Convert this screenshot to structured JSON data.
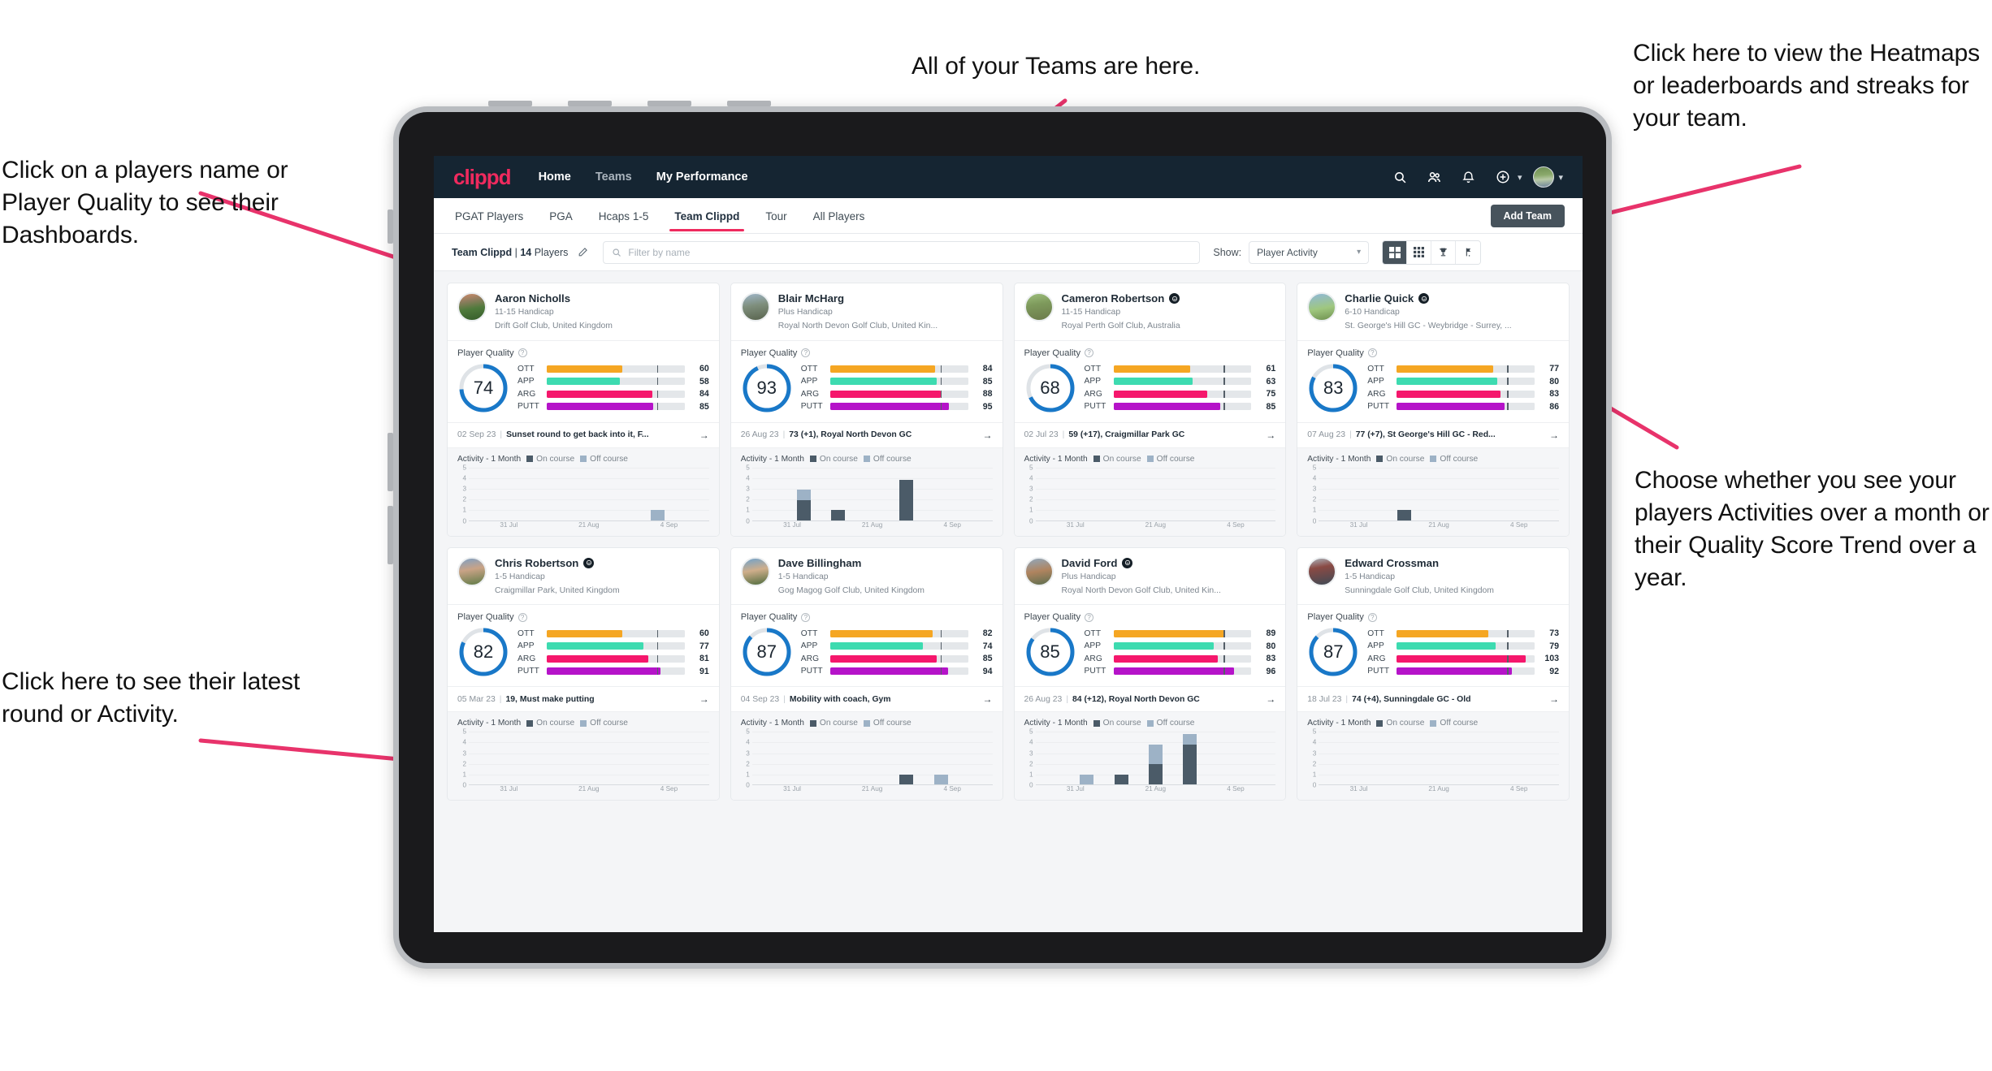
{
  "annotations": [
    {
      "id": "anno-players",
      "text": "Click on a players name or Player Quality to see their Dashboards."
    },
    {
      "id": "anno-teams",
      "text": "All of your Teams are here."
    },
    {
      "id": "anno-heatmaps",
      "text": "Click here to view the Heatmaps or leaderboards and streaks for your team."
    },
    {
      "id": "anno-activity-toggle",
      "text": "Choose whether you see your players Activities over a month or their Quality Score Trend over a year."
    },
    {
      "id": "anno-latest-round",
      "text": "Click here to see their latest round or Activity."
    }
  ],
  "topnav": {
    "logo": "clippd",
    "links": [
      {
        "label": "Home",
        "active": true
      },
      {
        "label": "Teams",
        "active": false
      },
      {
        "label": "My Performance",
        "active": true
      }
    ],
    "icons": [
      "search-icon",
      "people-icon",
      "bell-icon",
      "plus-circle-icon",
      "avatar-icon"
    ]
  },
  "tabs": {
    "items": [
      {
        "label": "PGAT Players",
        "active": false
      },
      {
        "label": "PGA",
        "active": false
      },
      {
        "label": "Hcaps 1-5",
        "active": false
      },
      {
        "label": "Team Clippd",
        "active": true
      },
      {
        "label": "Tour",
        "active": false
      },
      {
        "label": "All Players",
        "active": false
      }
    ],
    "add_team_label": "Add Team"
  },
  "filterbar": {
    "team_name": "Team Clippd",
    "separator": "|",
    "player_count": "14",
    "players_word": "Players",
    "edit_icon": "pencil-icon",
    "search_placeholder": "Filter by name",
    "show_label": "Show:",
    "show_value": "Player Activity",
    "views": [
      {
        "icon": "grid-large-icon",
        "active": true
      },
      {
        "icon": "grid-dense-icon",
        "active": false
      },
      {
        "icon": "trophy-icon",
        "active": false
      },
      {
        "icon": "golf-flag-icon",
        "active": false
      }
    ]
  },
  "metric_colors": {
    "OTT": "#f5a623",
    "APP": "#3ddbb0",
    "ARG": "#f5176c",
    "PUTT": "#b513c9",
    "ring": "#1978c8",
    "ring_track": "#dfe3e7"
  },
  "card_labels": {
    "player_quality": "Player Quality",
    "activity": "Activity - 1 Month",
    "on_course": "On course",
    "off_course": "Off course",
    "metrics": [
      "OTT",
      "APP",
      "ARG",
      "PUTT"
    ],
    "y_ticks": [
      "5",
      "4",
      "3",
      "2",
      "1",
      "0"
    ],
    "x_ticks": [
      "31 Jul",
      "21 Aug",
      "4 Sep"
    ]
  },
  "players": [
    {
      "name": "Aaron Nicholls",
      "verified": false,
      "handicap": "11-15 Handicap",
      "club": "Drift Golf Club, United Kingdom",
      "quality": 74,
      "metrics": [
        {
          "k": "OTT",
          "v": 60
        },
        {
          "k": "APP",
          "v": 58
        },
        {
          "k": "ARG",
          "v": 84
        },
        {
          "k": "PUTT",
          "v": 85
        }
      ],
      "latest_date": "02 Sep 23",
      "latest_text": "Sunset round to get back into it, F...",
      "chart_data": {
        "type": "bar",
        "x": [
          "31 Jul",
          "21 Aug",
          "4 Sep"
        ],
        "ylim": [
          0,
          5
        ],
        "series": [
          {
            "name": "On course",
            "values": [
              0,
              0,
              0,
              0,
              0,
              0,
              0
            ]
          },
          {
            "name": "Off course",
            "values": [
              0,
              0,
              0,
              0,
              0,
              1,
              0
            ]
          }
        ]
      }
    },
    {
      "name": "Blair McHarg",
      "verified": false,
      "handicap": "Plus Handicap",
      "club": "Royal North Devon Golf Club, United Kin...",
      "quality": 93,
      "metrics": [
        {
          "k": "OTT",
          "v": 84
        },
        {
          "k": "APP",
          "v": 85
        },
        {
          "k": "ARG",
          "v": 88
        },
        {
          "k": "PUTT",
          "v": 95
        }
      ],
      "latest_date": "26 Aug 23",
      "latest_text": "73 (+1), Royal North Devon GC",
      "chart_data": {
        "type": "bar",
        "x": [
          "31 Jul",
          "21 Aug",
          "4 Sep"
        ],
        "ylim": [
          0,
          5
        ],
        "series": [
          {
            "name": "On course",
            "values": [
              0,
              2,
              1,
              0,
              4,
              0,
              0
            ]
          },
          {
            "name": "Off course",
            "values": [
              0,
              1,
              0,
              0,
              0,
              0,
              0
            ]
          }
        ]
      }
    },
    {
      "name": "Cameron Robertson",
      "verified": true,
      "handicap": "11-15 Handicap",
      "club": "Royal Perth Golf Club, Australia",
      "quality": 68,
      "metrics": [
        {
          "k": "OTT",
          "v": 61
        },
        {
          "k": "APP",
          "v": 63
        },
        {
          "k": "ARG",
          "v": 75
        },
        {
          "k": "PUTT",
          "v": 85
        }
      ],
      "latest_date": "02 Jul 23",
      "latest_text": "59 (+17), Craigmillar Park GC",
      "chart_data": {
        "type": "bar",
        "x": [
          "31 Jul",
          "21 Aug",
          "4 Sep"
        ],
        "ylim": [
          0,
          5
        ],
        "series": [
          {
            "name": "On course",
            "values": [
              0,
              0,
              0,
              0,
              0,
              0,
              0
            ]
          },
          {
            "name": "Off course",
            "values": [
              0,
              0,
              0,
              0,
              0,
              0,
              0
            ]
          }
        ]
      }
    },
    {
      "name": "Charlie Quick",
      "verified": true,
      "handicap": "6-10 Handicap",
      "club": "St. George's Hill GC - Weybridge - Surrey, ...",
      "quality": 83,
      "metrics": [
        {
          "k": "OTT",
          "v": 77
        },
        {
          "k": "APP",
          "v": 80
        },
        {
          "k": "ARG",
          "v": 83
        },
        {
          "k": "PUTT",
          "v": 86
        }
      ],
      "latest_date": "07 Aug 23",
      "latest_text": "77 (+7), St George's Hill GC - Red...",
      "chart_data": {
        "type": "bar",
        "x": [
          "31 Jul",
          "21 Aug",
          "4 Sep"
        ],
        "ylim": [
          0,
          5
        ],
        "series": [
          {
            "name": "On course",
            "values": [
              0,
              0,
              1,
              0,
              0,
              0,
              0
            ]
          },
          {
            "name": "Off course",
            "values": [
              0,
              0,
              0,
              0,
              0,
              0,
              0
            ]
          }
        ]
      }
    },
    {
      "name": "Chris Robertson",
      "verified": true,
      "handicap": "1-5 Handicap",
      "club": "Craigmillar Park, United Kingdom",
      "quality": 82,
      "metrics": [
        {
          "k": "OTT",
          "v": 60
        },
        {
          "k": "APP",
          "v": 77
        },
        {
          "k": "ARG",
          "v": 81
        },
        {
          "k": "PUTT",
          "v": 91
        }
      ],
      "latest_date": "05 Mar 23",
      "latest_text": "19, Must make putting",
      "chart_data": {
        "type": "bar",
        "x": [
          "31 Jul",
          "21 Aug",
          "4 Sep"
        ],
        "ylim": [
          0,
          5
        ],
        "series": [
          {
            "name": "On course",
            "values": [
              0,
              0,
              0,
              0,
              0,
              0,
              0
            ]
          },
          {
            "name": "Off course",
            "values": [
              0,
              0,
              0,
              0,
              0,
              0,
              0
            ]
          }
        ]
      }
    },
    {
      "name": "Dave Billingham",
      "verified": false,
      "handicap": "1-5 Handicap",
      "club": "Gog Magog Golf Club, United Kingdom",
      "quality": 87,
      "metrics": [
        {
          "k": "OTT",
          "v": 82
        },
        {
          "k": "APP",
          "v": 74
        },
        {
          "k": "ARG",
          "v": 85
        },
        {
          "k": "PUTT",
          "v": 94
        }
      ],
      "latest_date": "04 Sep 23",
      "latest_text": "Mobility with coach, Gym",
      "chart_data": {
        "type": "bar",
        "x": [
          "31 Jul",
          "21 Aug",
          "4 Sep"
        ],
        "ylim": [
          0,
          5
        ],
        "series": [
          {
            "name": "On course",
            "values": [
              0,
              0,
              0,
              0,
              1,
              0,
              0
            ]
          },
          {
            "name": "Off course",
            "values": [
              0,
              0,
              0,
              0,
              0,
              1,
              0
            ]
          }
        ]
      }
    },
    {
      "name": "David Ford",
      "verified": true,
      "handicap": "Plus Handicap",
      "club": "Royal North Devon Golf Club, United Kin...",
      "quality": 85,
      "metrics": [
        {
          "k": "OTT",
          "v": 89
        },
        {
          "k": "APP",
          "v": 80
        },
        {
          "k": "ARG",
          "v": 83
        },
        {
          "k": "PUTT",
          "v": 96
        }
      ],
      "latest_date": "26 Aug 23",
      "latest_text": "84 (+12), Royal North Devon GC",
      "chart_data": {
        "type": "bar",
        "x": [
          "31 Jul",
          "21 Aug",
          "4 Sep"
        ],
        "ylim": [
          0,
          5
        ],
        "series": [
          {
            "name": "On course",
            "values": [
              0,
              0,
              1,
              2,
              4,
              0,
              0
            ]
          },
          {
            "name": "Off course",
            "values": [
              0,
              1,
              0,
              2,
              1,
              0,
              0
            ]
          }
        ]
      }
    },
    {
      "name": "Edward Crossman",
      "verified": false,
      "handicap": "1-5 Handicap",
      "club": "Sunningdale Golf Club, United Kingdom",
      "quality": 87,
      "metrics": [
        {
          "k": "OTT",
          "v": 73
        },
        {
          "k": "APP",
          "v": 79
        },
        {
          "k": "ARG",
          "v": 103
        },
        {
          "k": "PUTT",
          "v": 92
        }
      ],
      "latest_date": "18 Jul 23",
      "latest_text": "74 (+4), Sunningdale GC - Old",
      "chart_data": {
        "type": "bar",
        "x": [
          "31 Jul",
          "21 Aug",
          "4 Sep"
        ],
        "ylim": [
          0,
          5
        ],
        "series": [
          {
            "name": "On course",
            "values": [
              0,
              0,
              0,
              0,
              0,
              0,
              0
            ]
          },
          {
            "name": "Off course",
            "values": [
              0,
              0,
              0,
              0,
              0,
              0,
              0
            ]
          }
        ]
      }
    }
  ]
}
